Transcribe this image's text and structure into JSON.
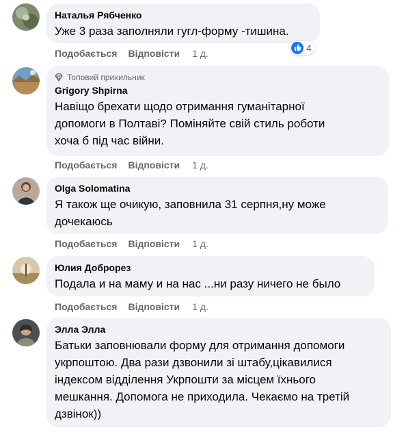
{
  "colors": {
    "bubble": "#f0f2f5",
    "meta_text": "#65676b",
    "like_blue": "#1877f2"
  },
  "comments": [
    {
      "author": "Наталья Рябченко",
      "text": "Уже 3 раза заполняли гугл-форму -тишина.",
      "like_label": "Подобається",
      "reply_label": "Відповісти",
      "time": "1 д.",
      "reaction_icon": "like-icon",
      "reaction_count": "4"
    },
    {
      "badge": "Топовий прихильник",
      "badge_icon": "diamond-icon",
      "author": "Grigory Shpirna",
      "text_lines": [
        "Навіщо брехати щодо отримання гуманітарної",
        "допомоги в Полтаві? Поміняйте свій стиль роботи",
        "хоча б під час війни."
      ],
      "like_label": "Подобається",
      "reply_label": "Відповісти",
      "time": "1 д."
    },
    {
      "author": "Olga Solomatina",
      "text_lines": [
        "Я також ще очикую, заповнила 31 серпня,ну може",
        "дочекаюсь"
      ],
      "like_label": "Подобається",
      "reply_label": "Відповісти",
      "time": "1 д."
    },
    {
      "author": "Юлия Доброрез",
      "text": "Подала и на маму и на нас ...ни разу ничего не было",
      "like_label": "Подобається",
      "reply_label": "Відповісти",
      "time": "1 д."
    },
    {
      "author": "Элла Элла",
      "text_lines": [
        "Батьки заповнювали форму для отримання допомоги",
        "укрпоштою. Два рази дзвонили зі штабу,цікавилися",
        "індексом відділення Укрпошти за місцем їхнього",
        "мешкання. Допомога не приходила. Чекаємо на третій",
        "дзвінок))"
      ]
    }
  ]
}
